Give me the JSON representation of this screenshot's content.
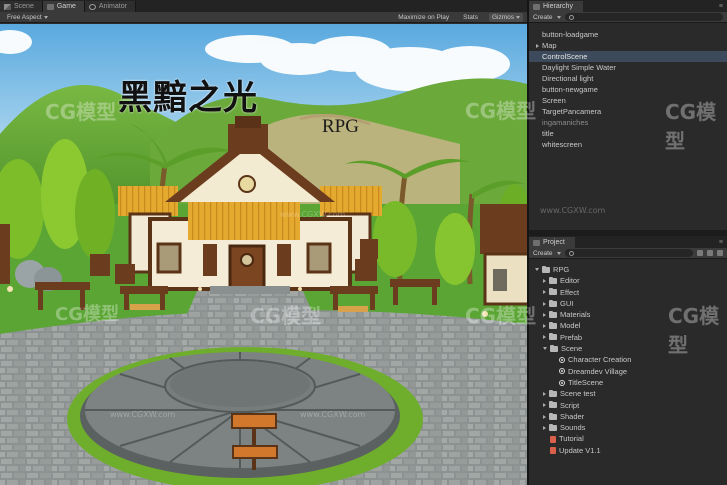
{
  "game_panel": {
    "tabs": [
      {
        "label": "Scene",
        "icon": "scene-icon"
      },
      {
        "label": "Game",
        "icon": "game-icon"
      },
      {
        "label": "Animator",
        "icon": "animator-icon"
      }
    ],
    "active_tab": 1,
    "aspect_label": "Free Aspect",
    "toolbar_right": [
      "Maximize on Play",
      "Stats",
      "Gizmos"
    ],
    "title_cn": "黑黯之光",
    "title_rpg": "RPG",
    "signs": [
      "",
      ""
    ]
  },
  "hierarchy": {
    "tab_label": "Hierarchy",
    "create_label": "Create",
    "search_placeholder": "",
    "items": [
      {
        "label": "button-loadgame",
        "state": "normal"
      },
      {
        "label": "Map",
        "state": "collapsed"
      },
      {
        "label": "ControlScene",
        "state": "selected"
      },
      {
        "label": "Daylight Simple Water",
        "state": "normal"
      },
      {
        "label": "Directional light",
        "state": "normal"
      },
      {
        "label": "button-newgame",
        "state": "normal"
      },
      {
        "label": "Screen",
        "state": "normal"
      },
      {
        "label": "TargetPancamera",
        "state": "normal"
      },
      {
        "label": "ingamaniches",
        "state": "dim"
      },
      {
        "label": "title",
        "state": "normal"
      },
      {
        "label": "whitescreen",
        "state": "normal"
      }
    ]
  },
  "project": {
    "tab_label": "Project",
    "create_label": "Create",
    "tree": [
      {
        "label": "RPG",
        "depth": 0,
        "kind": "folder",
        "open": true
      },
      {
        "label": "Editor",
        "depth": 1,
        "kind": "folder",
        "open": false
      },
      {
        "label": "Effect",
        "depth": 1,
        "kind": "folder",
        "open": false
      },
      {
        "label": "GUI",
        "depth": 1,
        "kind": "folder",
        "open": false
      },
      {
        "label": "Materials",
        "depth": 1,
        "kind": "folder",
        "open": false
      },
      {
        "label": "Model",
        "depth": 1,
        "kind": "folder",
        "open": false
      },
      {
        "label": "Prefab",
        "depth": 1,
        "kind": "folder",
        "open": false
      },
      {
        "label": "Scene",
        "depth": 1,
        "kind": "folder",
        "open": true
      },
      {
        "label": "Character Creation",
        "depth": 2,
        "kind": "scene"
      },
      {
        "label": "Dreamdev Village",
        "depth": 2,
        "kind": "scene"
      },
      {
        "label": "TitleScene",
        "depth": 2,
        "kind": "scene"
      },
      {
        "label": "Scene test",
        "depth": 1,
        "kind": "folder",
        "open": false
      },
      {
        "label": "Script",
        "depth": 1,
        "kind": "folder",
        "open": false
      },
      {
        "label": "Shader",
        "depth": 1,
        "kind": "folder",
        "open": false
      },
      {
        "label": "Sounds",
        "depth": 1,
        "kind": "folder",
        "open": false
      },
      {
        "label": "Tutorial",
        "depth": 1,
        "kind": "script"
      },
      {
        "label": "Update V1.1",
        "depth": 1,
        "kind": "script"
      }
    ]
  },
  "watermarks": [
    "CG模型",
    "CG模型",
    "CG模型",
    "CG模型",
    "CG模型",
    "CG模型",
    "CG模型"
  ],
  "watermark_urls": [
    "www.CGXW.com",
    "www.CGXW.com",
    "www.CGXW.com",
    "www.CGXW.com"
  ],
  "colors": {
    "sky": "#6fb7e6",
    "grass": "#58a83a",
    "roof": "#e0a22e",
    "wood": "#6b3d1e",
    "stone": "#8a8f8f",
    "selection": "#3c4a5c"
  }
}
